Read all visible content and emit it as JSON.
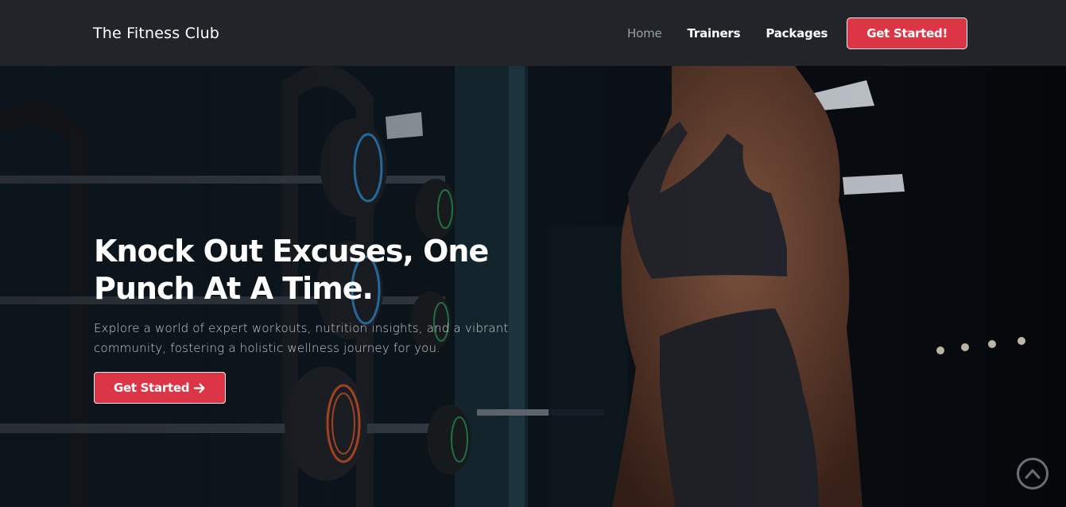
{
  "navbar": {
    "brand": "The Fitness Club",
    "links": [
      {
        "label": "Home",
        "active": true
      },
      {
        "label": "Trainers",
        "active": false
      },
      {
        "label": "Packages",
        "active": false
      }
    ],
    "cta_label": "Get Started!"
  },
  "hero": {
    "title_line1": "Knock Out Excuses, One",
    "title_line2": "Punch At A Time.",
    "text": "Explore a world of expert workouts, nutrition insights, and a vibrant community, fostering a holistic wellness journey for you.",
    "button_label": "Get Started",
    "button_icon": "arrow-right-icon"
  },
  "scroll_top": {
    "icon": "chevron-up-circle-icon"
  },
  "colors": {
    "accent": "#dc3545",
    "navbar_bg": "#212529",
    "hero_bg": "#0b0d10"
  }
}
